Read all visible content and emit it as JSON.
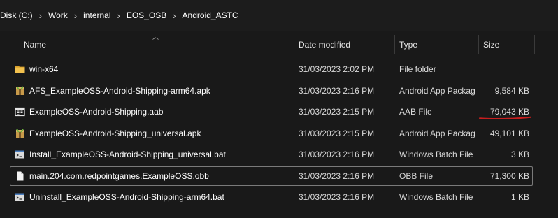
{
  "breadcrumb": [
    {
      "label": "Disk (C:)"
    },
    {
      "label": "Work"
    },
    {
      "label": "internal"
    },
    {
      "label": "EOS_OSB"
    },
    {
      "label": "Android_ASTC"
    }
  ],
  "columns": {
    "name": "Name",
    "date": "Date modified",
    "type": "Type",
    "size": "Size"
  },
  "files": [
    {
      "name": "win-x64",
      "date": "31/03/2023 2:02 PM",
      "type": "File folder",
      "size": "",
      "icon": "folder-icon"
    },
    {
      "name": "AFS_ExampleOSS-Android-Shipping-arm64.apk",
      "date": "31/03/2023 2:16 PM",
      "type": "Android App Package",
      "size": "9,584 KB",
      "icon": "apk-package-icon"
    },
    {
      "name": "ExampleOSS-Android-Shipping.aab",
      "date": "31/03/2023 2:15 PM",
      "type": "AAB File",
      "size": "79,043 KB",
      "icon": "aab-file-icon"
    },
    {
      "name": "ExampleOSS-Android-Shipping_universal.apk",
      "date": "31/03/2023 2:15 PM",
      "type": "Android App Package",
      "size": "49,101 KB",
      "icon": "apk-package-icon"
    },
    {
      "name": "Install_ExampleOSS-Android-Shipping_universal.bat",
      "date": "31/03/2023 2:16 PM",
      "type": "Windows Batch File",
      "size": "3 KB",
      "icon": "batch-file-icon"
    },
    {
      "name": "main.204.com.redpointgames.ExampleOSS.obb",
      "date": "31/03/2023 2:16 PM",
      "type": "OBB File",
      "size": "71,300 KB",
      "icon": "blank-file-icon"
    },
    {
      "name": "Uninstall_ExampleOSS-Android-Shipping-arm64.bat",
      "date": "31/03/2023 2:16 PM",
      "type": "Windows Batch File",
      "size": "1 KB",
      "icon": "batch-file-icon"
    }
  ],
  "colors": {
    "background": "#191919",
    "folder": "#e8b43a",
    "annotation": "#c81e1e"
  }
}
